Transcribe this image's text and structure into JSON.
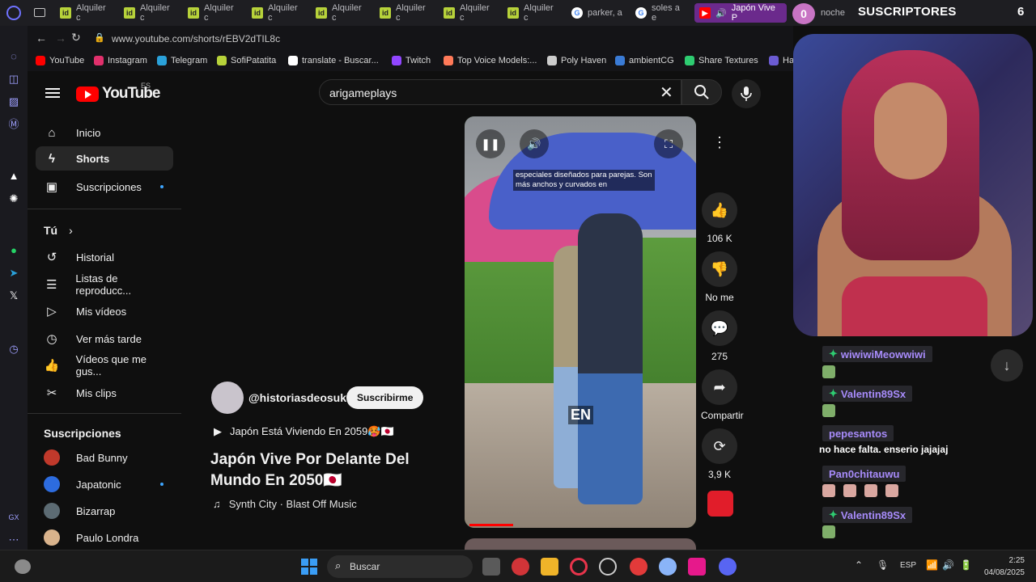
{
  "tabs": [
    {
      "label": "Alquiler c"
    },
    {
      "label": "Alquiler c"
    },
    {
      "label": "Alquiler c"
    },
    {
      "label": "Alquiler c"
    },
    {
      "label": "Alquiler c"
    },
    {
      "label": "Alquiler c"
    },
    {
      "label": "Alquiler c"
    },
    {
      "label": "Alquiler c"
    },
    {
      "label": "parker, a"
    },
    {
      "label": "soles a e"
    },
    {
      "label": "Japón Vive P"
    },
    {
      "label": "noche"
    }
  ],
  "browser": {
    "url": "www.youtube.com/shorts/rEBV2dTIL8c"
  },
  "bookmarks": [
    {
      "label": "YouTube",
      "color": "#ff0000"
    },
    {
      "label": "Instagram",
      "color": "#e1306c"
    },
    {
      "label": "Telegram",
      "color": "#2aa1da"
    },
    {
      "label": "SofiPatatita",
      "color": "#b7d23a"
    },
    {
      "label": "translate - Buscar...",
      "color": "#ffffff"
    },
    {
      "label": "Twitch",
      "color": "#9146ff"
    },
    {
      "label": "Top Voice Models:...",
      "color": "#ff7a59"
    },
    {
      "label": "Poly Haven",
      "color": "#cccccc"
    },
    {
      "label": "ambientCG",
      "color": "#3a7bd5"
    },
    {
      "label": "Share Textures",
      "color": "#2ecc71"
    },
    {
      "label": "Har",
      "color": "#6b5bd2"
    }
  ],
  "youtube": {
    "logo": "YouTube",
    "region": "ES",
    "search_value": "arigameplays",
    "nav": [
      {
        "label": "Inicio",
        "icon": "home-icon"
      },
      {
        "label": "Shorts",
        "icon": "shorts-icon"
      },
      {
        "label": "Suscripciones",
        "icon": "subscriptions-icon"
      }
    ],
    "you_title": "Tú",
    "you_items": [
      {
        "label": "Historial"
      },
      {
        "label": "Listas de reproducc..."
      },
      {
        "label": "Mis vídeos"
      },
      {
        "label": "Ver más tarde"
      },
      {
        "label": "Vídeos que me gus..."
      },
      {
        "label": "Mis clips"
      }
    ],
    "subs_title": "Suscripciones",
    "subs": [
      {
        "label": "Bad Bunny",
        "color": "#c0392b"
      },
      {
        "label": "Japatonic",
        "color": "#2d6cdf"
      },
      {
        "label": "Bizarrap",
        "color": "#5c6b73"
      },
      {
        "label": "Paulo Londra",
        "color": "#d9b38c"
      }
    ]
  },
  "short": {
    "channel": "@historiasdeosuke",
    "subscribe": "Suscribirme",
    "playlist": "Japón Está Viviendo En 2059🥵🇯🇵",
    "title": "Japón Vive Por Delante Del Mundo En 2050🇯🇵",
    "music": "Synth City · Blast Off Music",
    "caption": "especiales diseñados para parejas. Son más anchos y curvados en",
    "badge": "EN",
    "likes": "106 K",
    "dislike": "No me ...",
    "comments": "275",
    "share": "Compartir",
    "remix": "3,9 K"
  },
  "stream": {
    "sub_count_left": "0",
    "sub_label": "SUSCRIPTORES",
    "sub_count_right": "6",
    "chat": [
      {
        "user": "wiwiwiMeowwiwi",
        "badge": true,
        "msg": ""
      },
      {
        "user": "Valentin89Sx",
        "badge": true,
        "msg": ""
      },
      {
        "user": "pepesantos",
        "badge": false,
        "msg": "no hace falta. enserio jajajaj"
      },
      {
        "user": "Pan0chitauwu",
        "badge": false,
        "msg": ""
      },
      {
        "user": "Valentin89Sx",
        "badge": true,
        "msg": ""
      }
    ]
  },
  "taskbar": {
    "search_placeholder": "Buscar",
    "lang": "ESP",
    "time": "2:25",
    "date": "04/08/2025"
  }
}
